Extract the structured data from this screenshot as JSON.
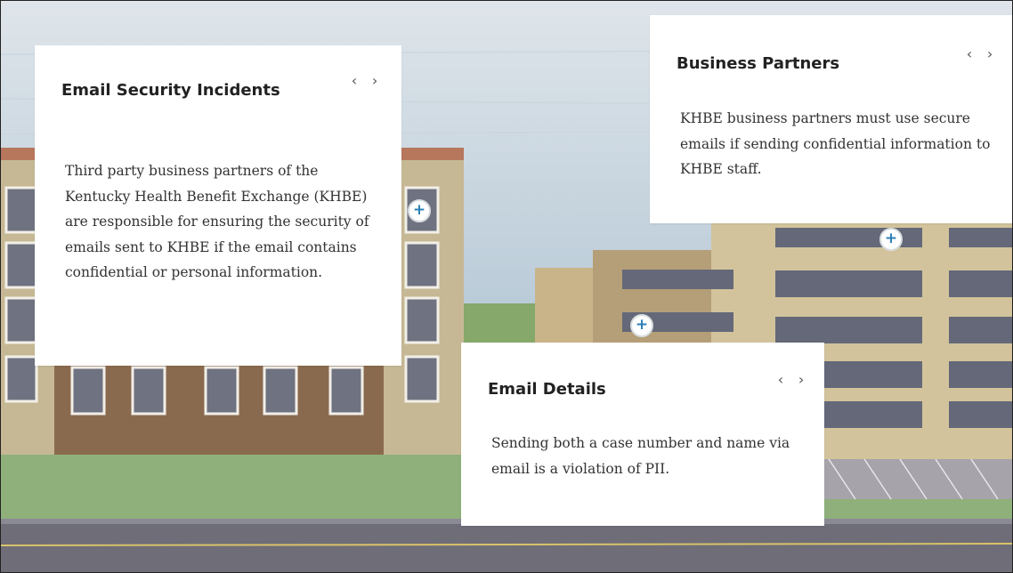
{
  "scene": {
    "colors": {
      "sky": "#b9cbd8",
      "building": "#b8a98a",
      "brick": "#8a6a4f",
      "grass": "#86a86b",
      "road": "#6e6d78",
      "roadLine": "#d9c36a"
    }
  },
  "cards": [
    {
      "title": "Email Security Incidents",
      "body": "Third party business partners of the Kentucky Health Benefit Exchange (KHBE) are responsible for ensuring the security of emails sent to KHBE if the email contains confidential or personal information.",
      "prev": "‹",
      "next": "›"
    },
    {
      "title": "Business Partners",
      "body": "KHBE business partners must use secure emails if sending confidential information to KHBE staff.",
      "prev": "‹",
      "next": "›"
    },
    {
      "title": "Email Details",
      "body": "Sending both a case number and name via email is a violation of PII.",
      "prev": "‹",
      "next": "›"
    }
  ],
  "hotspots": [
    "+",
    "+",
    "+"
  ]
}
